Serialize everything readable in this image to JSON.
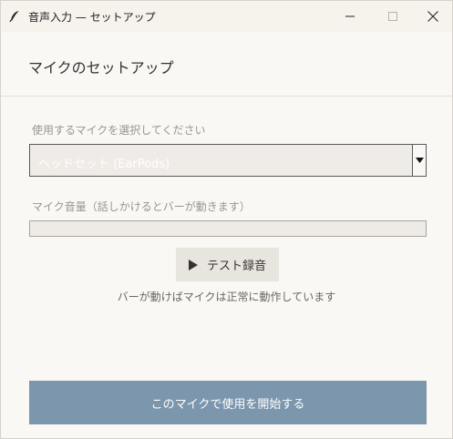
{
  "window": {
    "title": "音声入力 — セットアップ"
  },
  "header": {
    "title": "マイクのセットアップ"
  },
  "mic_select": {
    "label": "使用するマイクを選択してください",
    "selected": "ヘッドセット (EarPods)"
  },
  "volume": {
    "label": "マイク音量（話しかけるとバーが動きます）",
    "level_percent": 0
  },
  "test_button": {
    "label": "テスト録音"
  },
  "hint": "バーが動けばマイクは正常に動作しています",
  "start_button": {
    "label": "このマイクで使用を開始する"
  },
  "colors": {
    "accent": "#7b96ad",
    "background": "#faf8f5",
    "titlebar": "#f6f2ec"
  },
  "icons": {
    "app": "feather-icon",
    "play": "play-icon",
    "dropdown": "caret-down-icon"
  }
}
